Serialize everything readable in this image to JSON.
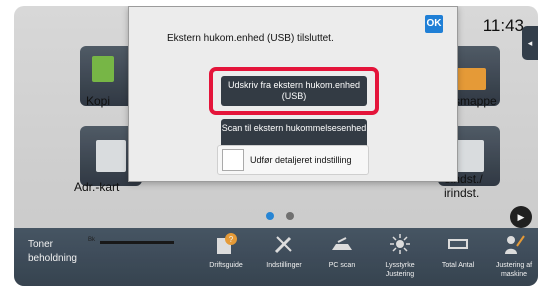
{
  "status": {
    "clock": "11:43"
  },
  "tiles": [
    {
      "label": "Kopi"
    },
    {
      "label": "Adr.-kart"
    },
    {
      "label": "rksmappe"
    },
    {
      "label": "eindst./\nirindst."
    }
  ],
  "dialog": {
    "message": "Ekstern hukom.enhed (USB) tilsluttet.",
    "ok_label": "OK",
    "print_button": "Udskriv fra ekstern hukom.enhed (USB)",
    "scan_button": "Scan til ekstern hukommelsesenhed",
    "detail_checkbox": "Udfør detaljeret indstilling"
  },
  "bottom_bar": {
    "toner_label": "Toner\nbeholdning",
    "toner_color": "Bk",
    "items": [
      {
        "label": "Driftsguide",
        "icon": "guide-icon"
      },
      {
        "label": "Indstillinger",
        "icon": "settings-icon"
      },
      {
        "label": "PC scan",
        "icon": "pc-scan-icon"
      },
      {
        "label": "Lysstyrke\nJustering",
        "icon": "brightness-icon"
      },
      {
        "label": "Total Antal",
        "icon": "counter-icon"
      },
      {
        "label": "Justering af\nmaskine",
        "icon": "machine-adjust-icon"
      }
    ]
  },
  "colors": {
    "accent_red": "#e4143a",
    "ok_blue": "#1f7fd6",
    "dark_button": "#333b44"
  }
}
